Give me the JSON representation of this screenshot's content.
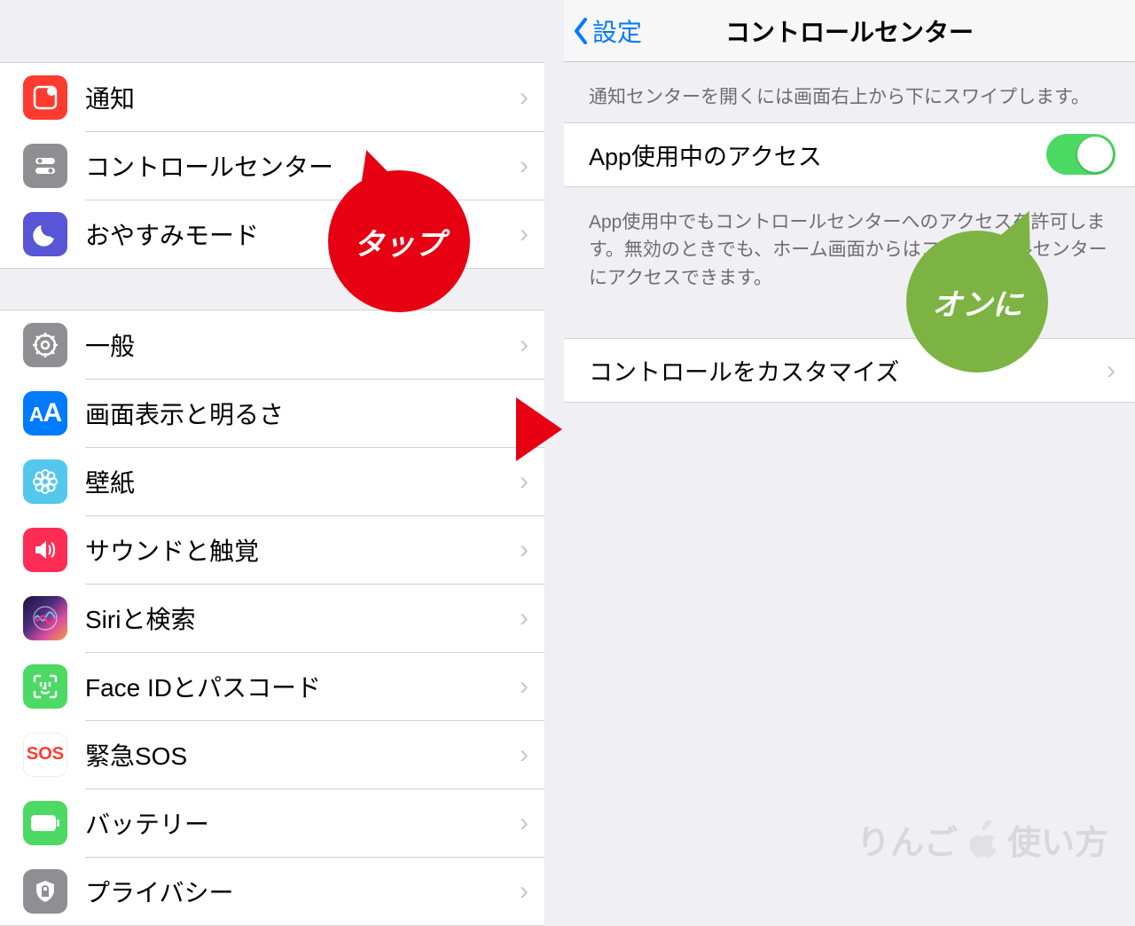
{
  "left": {
    "group1": [
      {
        "name": "notifications",
        "label": "通知",
        "icon": "notif"
      },
      {
        "name": "control-center",
        "label": "コントロールセンター",
        "icon": "cc"
      },
      {
        "name": "do-not-disturb",
        "label": "おやすみモード",
        "icon": "dnd"
      }
    ],
    "group2": [
      {
        "name": "general",
        "label": "一般",
        "icon": "gen"
      },
      {
        "name": "display",
        "label": "画面表示と明るさ",
        "icon": "disp"
      },
      {
        "name": "wallpaper",
        "label": "壁紙",
        "icon": "wall"
      },
      {
        "name": "sounds",
        "label": "サウンドと触覚",
        "icon": "sound"
      },
      {
        "name": "siri",
        "label": "Siriと検索",
        "icon": "siri"
      },
      {
        "name": "faceid",
        "label": "Face IDとパスコード",
        "icon": "face"
      },
      {
        "name": "sos",
        "label": "緊急SOS",
        "icon": "sos"
      },
      {
        "name": "battery",
        "label": "バッテリー",
        "icon": "batt"
      },
      {
        "name": "privacy",
        "label": "プライバシー",
        "icon": "priv"
      }
    ]
  },
  "right": {
    "back": "設定",
    "title": "コントロールセンター",
    "note_top": "通知センターを開くには画面右上から下にスワイプします。",
    "access_label": "App使用中のアクセス",
    "access_on": true,
    "note_access": "App使用中でもコントロールセンターへのアクセスを許可します。無効のときでも、ホーム画面からはコントロールセンターにアクセスできます。",
    "customize_label": "コントロールをカスタマイズ"
  },
  "callout_tap": "タップ",
  "callout_on": "オンに",
  "watermark_a": "りんご",
  "watermark_b": "使い方"
}
